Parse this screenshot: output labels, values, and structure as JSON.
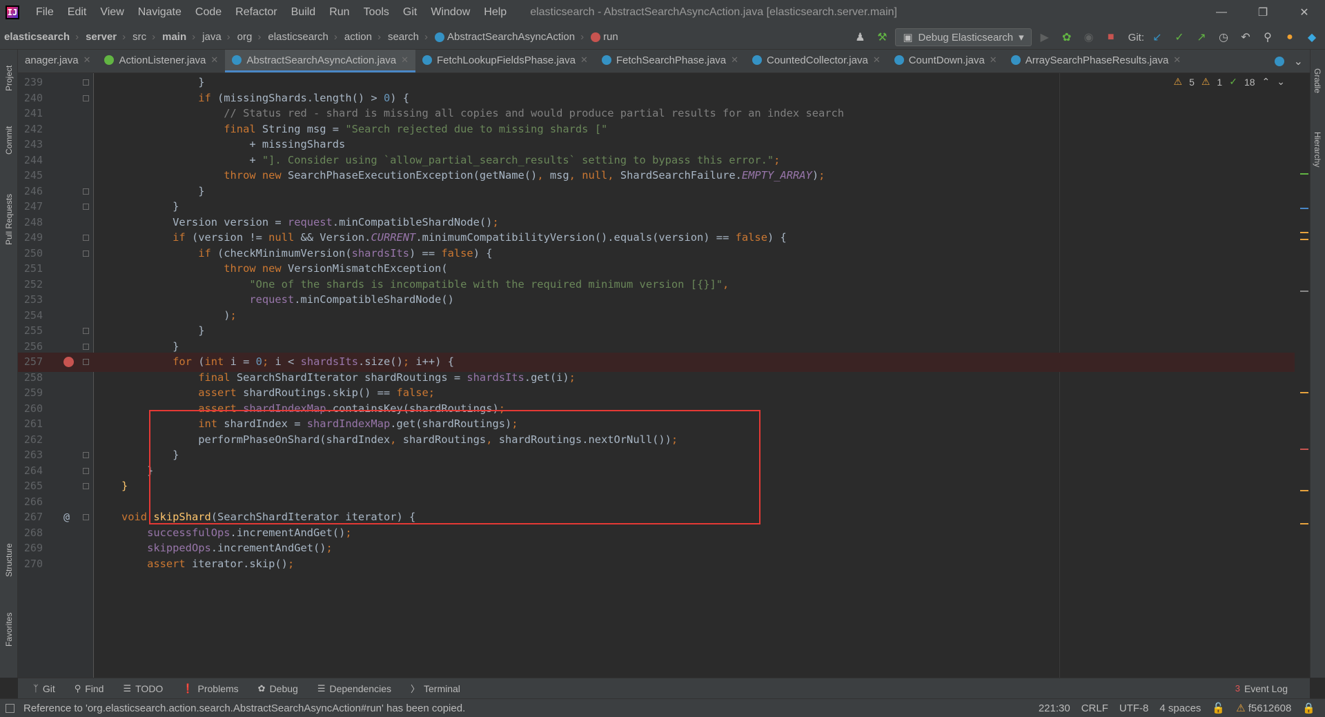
{
  "menubar": {
    "items": [
      "File",
      "Edit",
      "View",
      "Navigate",
      "Code",
      "Refactor",
      "Build",
      "Run",
      "Tools",
      "Git",
      "Window",
      "Help"
    ],
    "title": "elasticsearch - AbstractSearchAsyncAction.java [elasticsearch.server.main]"
  },
  "navbar": {
    "breadcrumbs": [
      "elasticsearch",
      "server",
      "src",
      "main",
      "java",
      "org",
      "elasticsearch",
      "action",
      "search",
      "AbstractSearchAsyncAction",
      "run"
    ],
    "run_config": "Debug Elasticsearch",
    "git_label": "Git:"
  },
  "left_tabs": [
    "Project",
    "Commit",
    "Pull Requests",
    "Structure",
    "Favorites"
  ],
  "right_tabs": [
    "Gradle",
    "Hierarchy"
  ],
  "tabs": [
    {
      "label": "anager.java",
      "icon": "class"
    },
    {
      "label": "ActionListener.java",
      "icon": "interface"
    },
    {
      "label": "AbstractSearchAsyncAction.java",
      "icon": "class",
      "active": true
    },
    {
      "label": "FetchLookupFieldsPhase.java",
      "icon": "class"
    },
    {
      "label": "FetchSearchPhase.java",
      "icon": "class"
    },
    {
      "label": "CountedCollector.java",
      "icon": "class"
    },
    {
      "label": "CountDown.java",
      "icon": "class"
    },
    {
      "label": "ArraySearchPhaseResults.java",
      "icon": "class"
    }
  ],
  "inspection": {
    "warnings": "5",
    "weak_warnings": "1",
    "ok": "18"
  },
  "code": {
    "line_numbers": [
      "239",
      "240",
      "241",
      "242",
      "243",
      "244",
      "245",
      "246",
      "247",
      "248",
      "249",
      "250",
      "251",
      "252",
      "253",
      "254",
      "255",
      "256",
      "257",
      "258",
      "259",
      "260",
      "261",
      "262",
      "263",
      "264",
      "265",
      "266",
      "267",
      "268",
      "269",
      "270"
    ]
  },
  "toolwindows": {
    "items": [
      "Git",
      "Find",
      "TODO",
      "Problems",
      "Debug",
      "Dependencies",
      "Terminal"
    ],
    "event_log": "Event Log",
    "event_count": "3"
  },
  "statusbar": {
    "message": "Reference to 'org.elasticsearch.action.search.AbstractSearchAsyncAction#run' has been copied.",
    "position": "221:30",
    "line_sep": "CRLF",
    "encoding": "UTF-8",
    "indent": "4 spaces",
    "branch": "f5612608"
  },
  "colors": {
    "accent": "#4a88c7",
    "highlight_box": "#e53935",
    "breakpoint": "#c75450"
  }
}
